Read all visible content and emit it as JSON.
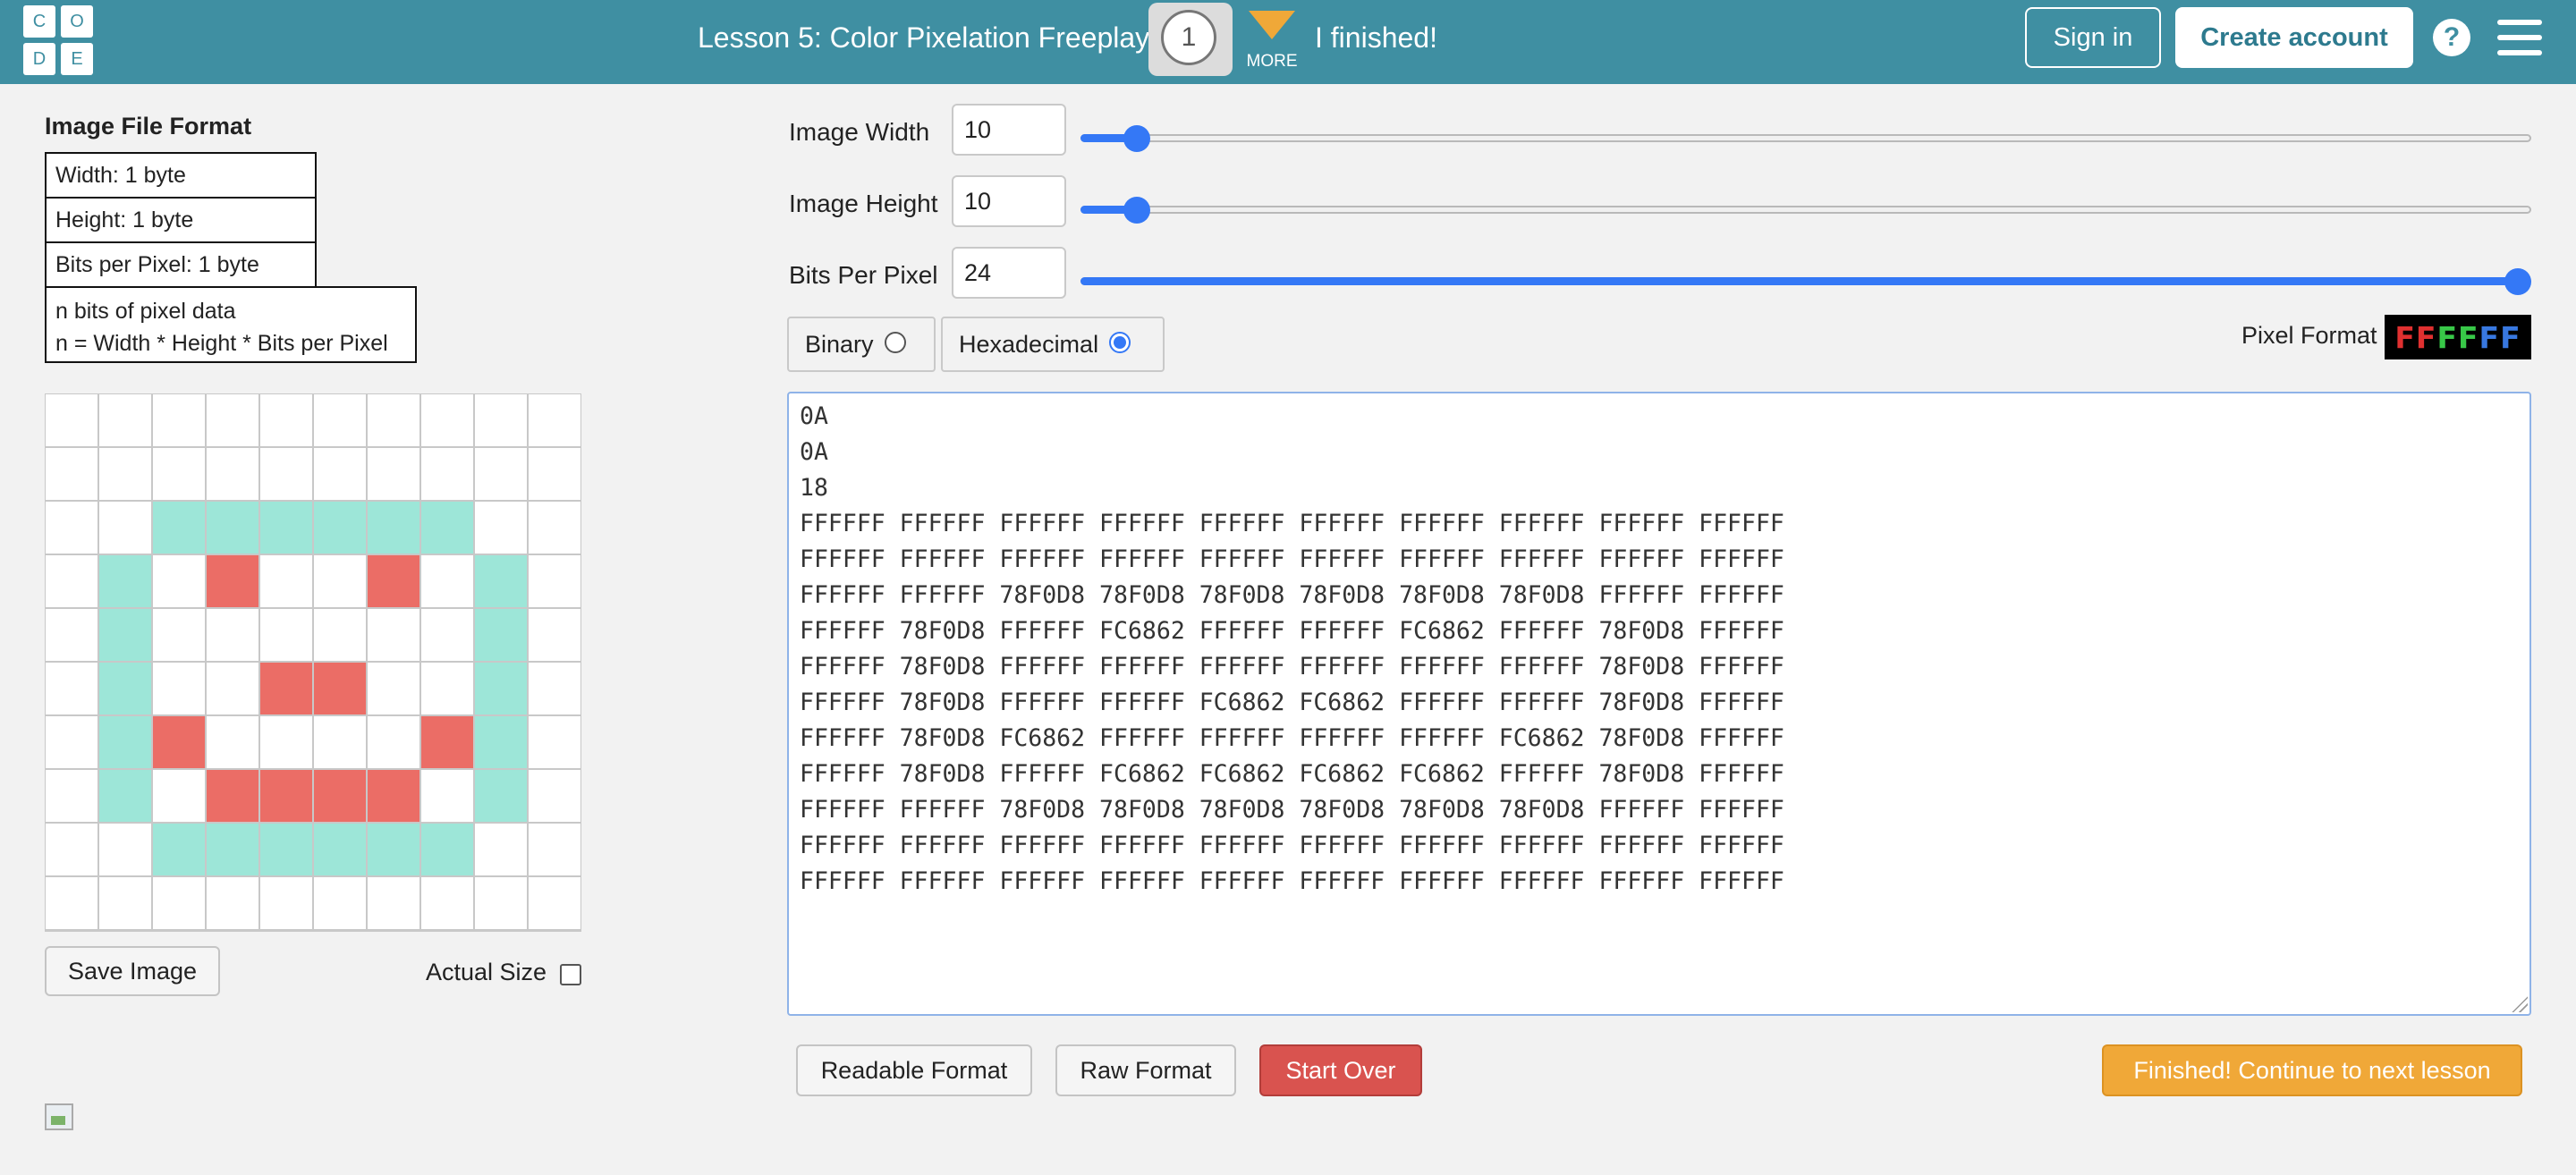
{
  "header": {
    "logo_letters": [
      "C",
      "O",
      "D",
      "E"
    ],
    "lesson_title": "Lesson 5: Color Pixelation Freeplay",
    "level_number": "1",
    "more_label": "MORE",
    "finished_text": "I finished!",
    "sign_in": "Sign in",
    "create_account": "Create account",
    "help_icon": "?",
    "bg_color": "#3f8fa2"
  },
  "format_panel": {
    "title": "Image File Format",
    "width_row": "Width: 1 byte",
    "height_row": "Height: 1 byte",
    "bpp_row": "Bits per Pixel: 1 byte",
    "pixel_data_line1": "n bits of pixel data",
    "pixel_data_line2": "n = Width * Height * Bits per Pixel"
  },
  "controls": {
    "image_width": {
      "label": "Image Width",
      "value": "10",
      "slider_fraction": 0.03
    },
    "image_height": {
      "label": "Image Height",
      "value": "10",
      "slider_fraction": 0.03
    },
    "bits_per_pixel": {
      "label": "Bits Per Pixel",
      "value": "24",
      "slider_fraction": 1.0
    },
    "binary_label": "Binary",
    "hex_label": "Hexadecimal",
    "selected_mode": "hexadecimal",
    "pixel_format_label": "Pixel Format",
    "pixel_format_glyphs": [
      {
        "text": "FF",
        "color": "#e03030"
      },
      {
        "text": "FF",
        "color": "#38c848"
      },
      {
        "text": "FF",
        "color": "#3878e0"
      }
    ]
  },
  "pixel_data": [
    "0A",
    "0A",
    "18",
    "FFFFFF FFFFFF FFFFFF FFFFFF FFFFFF FFFFFF FFFFFF FFFFFF FFFFFF FFFFFF",
    "FFFFFF FFFFFF FFFFFF FFFFFF FFFFFF FFFFFF FFFFFF FFFFFF FFFFFF FFFFFF",
    "FFFFFF FFFFFF 78F0D8 78F0D8 78F0D8 78F0D8 78F0D8 78F0D8 FFFFFF FFFFFF",
    "FFFFFF 78F0D8 FFFFFF FC6862 FFFFFF FFFFFF FC6862 FFFFFF 78F0D8 FFFFFF",
    "FFFFFF 78F0D8 FFFFFF FFFFFF FFFFFF FFFFFF FFFFFF FFFFFF 78F0D8 FFFFFF",
    "FFFFFF 78F0D8 FFFFFF FFFFFF FC6862 FC6862 FFFFFF FFFFFF 78F0D8 FFFFFF",
    "FFFFFF 78F0D8 FC6862 FFFFFF FFFFFF FFFFFF FFFFFF FC6862 78F0D8 FFFFFF",
    "FFFFFF 78F0D8 FFFFFF FC6862 FC6862 FC6862 FC6862 FFFFFF 78F0D8 FFFFFF",
    "FFFFFF FFFFFF 78F0D8 78F0D8 78F0D8 78F0D8 78F0D8 78F0D8 FFFFFF FFFFFF",
    "FFFFFF FFFFFF FFFFFF FFFFFF FFFFFF FFFFFF FFFFFF FFFFFF FFFFFF FFFFFF",
    "FFFFFF FFFFFF FFFFFF FFFFFF FFFFFF FFFFFF FFFFFF FFFFFF FFFFFF FFFFFF"
  ],
  "canvas_colors": {
    "FFFFFF": "#ffffff",
    "78F0D8": "#9de6d8",
    "FC6862": "#eb6d66"
  },
  "bottom_left": {
    "save_image": "Save Image",
    "actual_size": "Actual Size",
    "broken_image_icon": "broken-image-icon"
  },
  "buttons": {
    "readable_format": "Readable Format",
    "raw_format": "Raw Format",
    "start_over": "Start Over",
    "continue": "Finished! Continue to next lesson"
  }
}
